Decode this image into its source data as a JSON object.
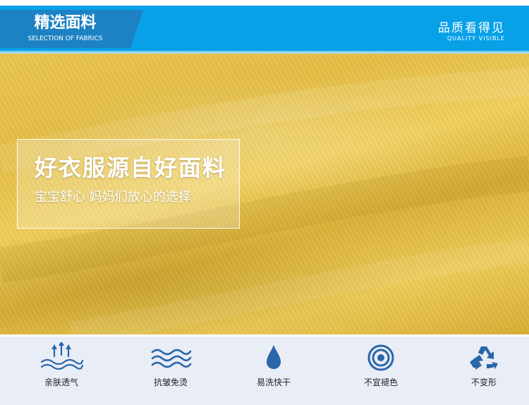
{
  "header": {
    "section_title": "精选面料",
    "section_subtitle": "SELECTION OF FABRICS",
    "quality_title": "品质看得见",
    "quality_subtitle": "QUALITY VISIBLE"
  },
  "hero": {
    "headline": "好衣服源自好面料",
    "subline": "宝宝舒心 妈妈们放心的选择"
  },
  "features": [
    {
      "label": "亲肤透气",
      "icon": "breathable-arrows-icon"
    },
    {
      "label": "抗皱免烫",
      "icon": "wave-lines-icon"
    },
    {
      "label": "易洗快干",
      "icon": "water-drop-icon"
    },
    {
      "label": "不宜褪色",
      "icon": "target-circles-icon"
    },
    {
      "label": "不变形",
      "icon": "recycle-icon"
    }
  ],
  "colors": {
    "header_blue": "#08a1e8",
    "label_blue": "#1d82c3",
    "icon_blue": "#2a66a8",
    "fabric_yellow": "#e6c04a",
    "feature_bg": "#e9edf6"
  }
}
